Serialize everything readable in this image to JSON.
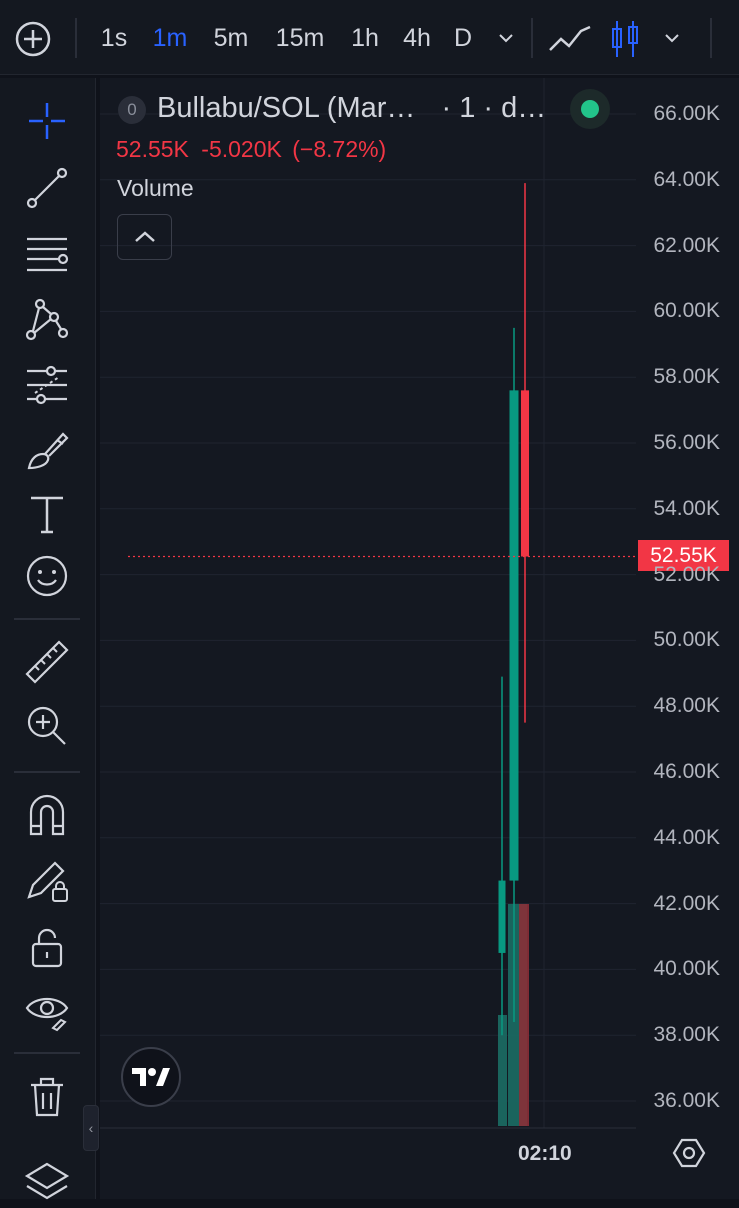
{
  "toolbar": {
    "intervals": [
      "1s",
      "1m",
      "5m",
      "15m",
      "1h",
      "4h",
      "D"
    ],
    "active_interval": "1m",
    "icons": [
      "add-symbol-icon",
      "interval-dropdown-icon",
      "line-chart-icon",
      "candles-icon",
      "chart-type-dropdown-icon"
    ]
  },
  "left_tools": {
    "icons": [
      "crosshair-icon",
      "trend-line-icon",
      "fib-retracement-icon",
      "pattern-icon",
      "prediction-icon",
      "brush-icon",
      "text-icon",
      "emoji-icon",
      "ruler-icon",
      "zoom-in-icon",
      "magnet-icon",
      "lock-drawings-icon",
      "unlock-icon",
      "eye-icon",
      "trash-icon",
      "layers-icon"
    ]
  },
  "legend": {
    "badge": "0",
    "title": "Bullabu/SOL (Mar…",
    "interval_text": "· 1 · d…",
    "last_price": "52.55K",
    "change": "-5.020K",
    "change_pct": "(−8.72%)",
    "volume_label": "Volume"
  },
  "colors": {
    "up": "#26a69a",
    "up_bright": "#089981",
    "down": "#f23645",
    "accent": "#2962ff",
    "status": "#22c48a"
  },
  "price_axis": {
    "ticks": [
      "66.00K",
      "64.00K",
      "62.00K",
      "60.00K",
      "58.00K",
      "56.00K",
      "54.00K",
      "52.00K",
      "50.00K",
      "48.00K",
      "46.00K",
      "44.00K",
      "42.00K",
      "40.00K",
      "38.00K",
      "36.00K"
    ],
    "current_price_label": "52.55K"
  },
  "time_axis": {
    "label": "02:10"
  },
  "chart_data": {
    "type": "candlestick",
    "ylim": [
      35.2,
      66.6
    ],
    "unit": "K",
    "current_price": 52.55,
    "candles": [
      {
        "open": 40.5,
        "high": 48.9,
        "low": 38.0,
        "close": 42.7,
        "direction": "up"
      },
      {
        "open": 42.7,
        "high": 59.5,
        "low": 38.4,
        "close": 57.6,
        "direction": "up"
      },
      {
        "open": 57.6,
        "high": 63.9,
        "low": 47.5,
        "close": 52.55,
        "direction": "down"
      }
    ],
    "volume": [
      {
        "value": 0.37,
        "direction": "up"
      },
      {
        "value": 0.74,
        "direction": "up"
      },
      {
        "value": 0.74,
        "direction": "up"
      },
      {
        "value": 0.74,
        "direction": "down"
      }
    ]
  }
}
